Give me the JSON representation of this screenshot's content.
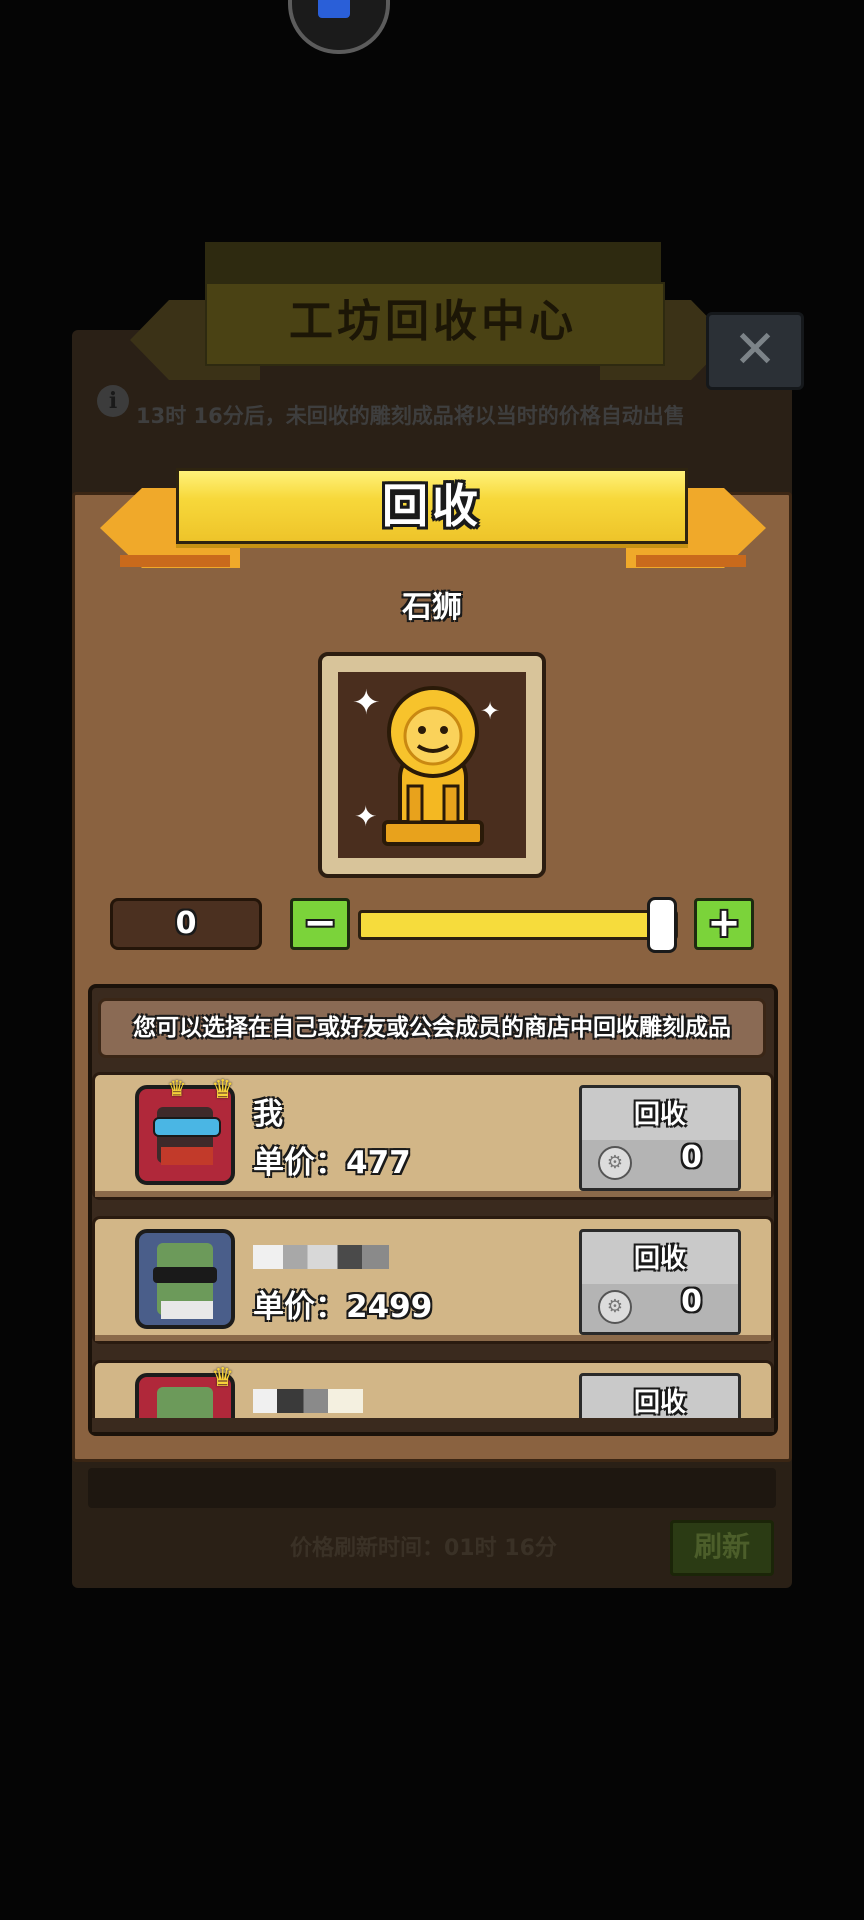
{
  "background": {
    "title": "工坊回收中心",
    "close_label": "✕",
    "info_text": "13时 16分后，未回收的雕刻成品将以当时的价格自动出售",
    "refresh_time_text": "价格刷新时间：01时 16分",
    "refresh_label": "刷新"
  },
  "modal": {
    "title": "回收",
    "item_name": "石狮",
    "item_icon": "golden-lion-statue",
    "quantity": "0",
    "minus_label": "−",
    "plus_label": "+",
    "slider_fraction": 0.95,
    "notice": "您可以选择在自己或好友或公会成员的商店中回收雕刻成品",
    "rows": [
      {
        "name": "我",
        "price_label": "单价：",
        "price": "477",
        "button_label": "回收",
        "count": "0"
      },
      {
        "name": "",
        "price_label": "单价：",
        "price": "2499",
        "button_label": "回收",
        "count": "0"
      },
      {
        "name": "",
        "button_label": "回收"
      }
    ]
  }
}
